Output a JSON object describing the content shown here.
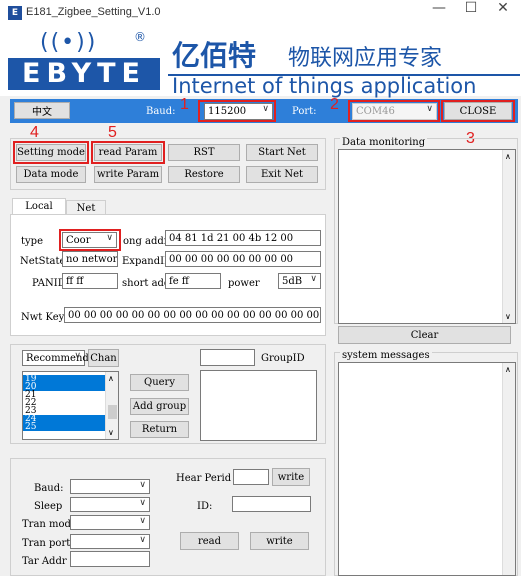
{
  "window": {
    "title": "E181_Zigbee_Setting_V1.0",
    "icon": "E",
    "minimize": "—",
    "maximize": "☐",
    "close": "✕"
  },
  "banner": {
    "wave": "((•))",
    "reg": "®",
    "logo_en": "EBYTE",
    "brand_cn_main": "亿佰特",
    "brand_cn_sub": "物联网应用专家",
    "brand_en": "Internet of things application expert"
  },
  "topbar": {
    "lang_button": "中文",
    "baud_label": "Baud:",
    "baud_value": "115200",
    "port_label": "Port:",
    "port_value": "COM46",
    "close_button": "CLOSE"
  },
  "annotations": {
    "n1": "1",
    "n2": "2",
    "n3": "3",
    "n4": "4",
    "n5": "5"
  },
  "buttons": {
    "setting_mode": "Setting mode",
    "read_param": "read Param",
    "rst": "RST",
    "start_net": "Start Net",
    "data_mode": "Data mode",
    "write_param": "write Param",
    "restore": "Restore",
    "exit_net": "Exit Net"
  },
  "tabs": {
    "local": "Local Cmd",
    "net": "Net Cmd"
  },
  "local": {
    "type_label": "type",
    "type_value": "Coor",
    "long_addr_label": "ong addr",
    "long_addr_value": "04 81 1d 21 00 4b 12 00",
    "netstate_label": "NetState",
    "netstate_value": "no network",
    "expandid_label": "ExpandID",
    "expandid_value": "00 00 00 00 00 00 00 00",
    "panid_label": "PANID",
    "panid_value": "ff ff",
    "short_addr_label": "short add",
    "short_addr_value": "fe ff",
    "power_label": "power",
    "power_value": "5dB",
    "nwtkey_label": "Nwt Key",
    "nwtkey_value": "00 00 00 00 00 00 00 00 00 00 00 00 00 00 00 00"
  },
  "group": {
    "mode_value": "Recommend",
    "chan_button": "Chan",
    "groupid_label": "GroupID",
    "query": "Query",
    "add_group": "Add group",
    "return": "Return",
    "list": [
      {
        "label": "19",
        "sel": true
      },
      {
        "label": "20",
        "sel": true
      },
      {
        "label": "21",
        "sel": false
      },
      {
        "label": "22",
        "sel": false
      },
      {
        "label": "23",
        "sel": false
      },
      {
        "label": "24",
        "sel": true
      },
      {
        "label": "25",
        "sel": true
      }
    ]
  },
  "bottom": {
    "baud_label": "Baud:",
    "sleep_label": "Sleep",
    "tranmode_label": "Tran mode",
    "tranport_label": "Tran port",
    "taraddr_label": "Tar Addr",
    "hear_label": "Hear Perid",
    "write_button": "write",
    "id_label": "ID:",
    "read_button": "read",
    "write2_button": "write"
  },
  "right": {
    "data_monitoring": "Data monitoring",
    "clear": "Clear",
    "system_messages": "system messages"
  },
  "colors": {
    "brand": "#1d56a8",
    "bar": "#2e7fd9",
    "annotation": "#e02020",
    "selection": "#0078d7"
  }
}
